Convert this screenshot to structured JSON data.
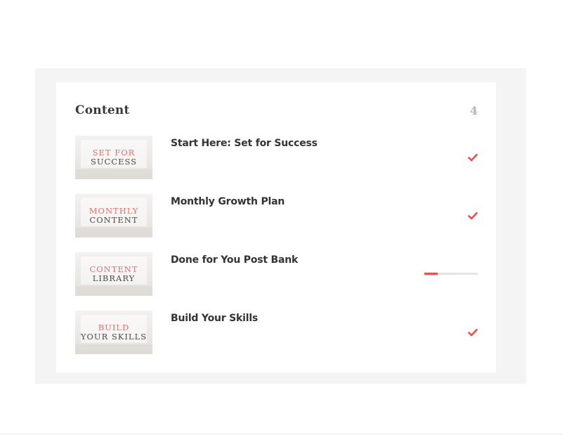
{
  "content_panel": {
    "title": "Content",
    "count": "4",
    "accent_color": "#e8514f",
    "items": [
      {
        "thumb_line1": "SET FOR",
        "thumb_line2": "SUCCESS",
        "title": "Start Here: Set for Success",
        "status": "complete",
        "status_icon": "check-icon"
      },
      {
        "thumb_line1": "MONTHLY",
        "thumb_line2": "CONTENT",
        "title": "Monthly Growth Plan",
        "status": "complete",
        "status_icon": "check-icon"
      },
      {
        "thumb_line1": "CONTENT",
        "thumb_line2": "LIBRARY",
        "title": "Done for You Post Bank",
        "status": "in-progress",
        "progress": 0.25
      },
      {
        "thumb_line1": "BUILD",
        "thumb_line2": "YOUR SKILLS",
        "title": "Build Your Skills",
        "status": "complete",
        "status_icon": "check-icon"
      }
    ]
  }
}
